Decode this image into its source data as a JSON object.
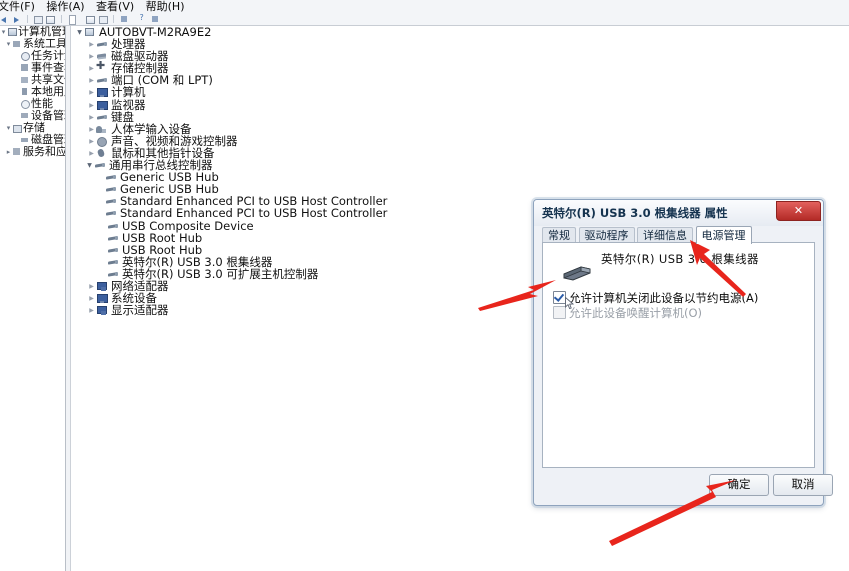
{
  "menubar": {
    "items": [
      {
        "label": "文件(F)"
      },
      {
        "label": "操作(A)"
      },
      {
        "label": "查看(V)"
      },
      {
        "label": "帮助(H)"
      }
    ]
  },
  "toolbar": {
    "icons": [
      "back-arrow-icon",
      "forward-arrow-icon",
      "up-folder-icon",
      "window-icon",
      "properties-icon",
      "list-view-icon",
      "refresh-icon",
      "export-icon",
      "help-icon"
    ]
  },
  "sidebar": {
    "items": [
      {
        "label": "计算机管理(本地",
        "icon": "computer-icon",
        "indent": 0,
        "expander": "-"
      },
      {
        "label": "系统工具",
        "icon": "tools-folder-icon",
        "indent": 1,
        "expander": "-"
      },
      {
        "label": "任务计划程",
        "icon": "clock-icon",
        "indent": 2,
        "expander": ""
      },
      {
        "label": "事件查看器",
        "icon": "event-log-icon",
        "indent": 2,
        "expander": ""
      },
      {
        "label": "共享文件夹",
        "icon": "shared-folder-icon",
        "indent": 2,
        "expander": ""
      },
      {
        "label": "本地用户和",
        "icon": "users-icon",
        "indent": 2,
        "expander": ""
      },
      {
        "label": "性能",
        "icon": "performance-icon",
        "indent": 2,
        "expander": ""
      },
      {
        "label": "设备管理器",
        "icon": "device-manager-icon",
        "indent": 2,
        "expander": ""
      },
      {
        "label": "存储",
        "icon": "storage-icon",
        "indent": 1,
        "expander": "-"
      },
      {
        "label": "磁盘管理",
        "icon": "disk-icon",
        "indent": 2,
        "expander": ""
      },
      {
        "label": "服务和应用程",
        "icon": "services-icon",
        "indent": 1,
        "expander": "+"
      }
    ]
  },
  "device_tree": {
    "root": {
      "label": "AUTOBVT-M2RA9E2",
      "icon": "computer-icon",
      "expander": "▼"
    },
    "items": [
      {
        "label": "处理器",
        "icon": "plug-icon",
        "indent": 1,
        "expander": "▸"
      },
      {
        "label": "磁盘驱动器",
        "icon": "disk-drive-icon",
        "indent": 1,
        "expander": "▸"
      },
      {
        "label": "存储控制器",
        "icon": "storage-controller-icon",
        "indent": 1,
        "expander": "▸"
      },
      {
        "label": "端口 (COM 和 LPT)",
        "icon": "port-icon",
        "indent": 1,
        "expander": "▸"
      },
      {
        "label": "计算机",
        "icon": "computer-node-icon",
        "indent": 1,
        "expander": "▸"
      },
      {
        "label": "监视器",
        "icon": "monitor-icon",
        "indent": 1,
        "expander": "▸"
      },
      {
        "label": "键盘",
        "icon": "keyboard-icon",
        "indent": 1,
        "expander": "▸"
      },
      {
        "label": "人体学输入设备",
        "icon": "hid-icon",
        "indent": 1,
        "expander": "▸"
      },
      {
        "label": "声音、视频和游戏控制器",
        "icon": "sound-icon",
        "indent": 1,
        "expander": "▸"
      },
      {
        "label": "鼠标和其他指针设备",
        "icon": "mouse-icon",
        "indent": 1,
        "expander": "▸"
      },
      {
        "label": "通用串行总线控制器",
        "icon": "usb-icon",
        "indent": 1,
        "expander": "▼"
      },
      {
        "label": "Generic USB Hub",
        "icon": "usb-device-icon",
        "indent": 2,
        "expander": ""
      },
      {
        "label": "Generic USB Hub",
        "icon": "usb-device-icon",
        "indent": 2,
        "expander": ""
      },
      {
        "label": "Standard Enhanced PCI to USB Host Controller",
        "icon": "usb-device-icon",
        "indent": 2,
        "expander": ""
      },
      {
        "label": "Standard Enhanced PCI to USB Host Controller",
        "icon": "usb-device-icon",
        "indent": 2,
        "expander": ""
      },
      {
        "label": "USB Composite Device",
        "icon": "usb-device-icon",
        "indent": 2,
        "expander": ""
      },
      {
        "label": "USB Root Hub",
        "icon": "usb-device-icon",
        "indent": 2,
        "expander": ""
      },
      {
        "label": "USB Root Hub",
        "icon": "usb-device-icon",
        "indent": 2,
        "expander": ""
      },
      {
        "label": "英特尔(R) USB 3.0 根集线器",
        "icon": "usb-device-icon",
        "indent": 2,
        "expander": ""
      },
      {
        "label": "英特尔(R) USB 3.0 可扩展主机控制器",
        "icon": "usb-device-icon",
        "indent": 2,
        "expander": ""
      },
      {
        "label": "网络适配器",
        "icon": "network-icon",
        "indent": 1,
        "expander": "▸"
      },
      {
        "label": "系统设备",
        "icon": "system-device-icon",
        "indent": 1,
        "expander": "▸"
      },
      {
        "label": "显示适配器",
        "icon": "display-adapter-icon",
        "indent": 1,
        "expander": "▸"
      }
    ]
  },
  "dialog": {
    "title": "英特尔(R) USB 3.0 根集线器 属性",
    "close_label": "✕",
    "tabs": [
      {
        "label": "常规",
        "active": false
      },
      {
        "label": "驱动程序",
        "active": false
      },
      {
        "label": "详细信息",
        "active": false
      },
      {
        "label": "电源管理",
        "active": true
      }
    ],
    "device_name": "英特尔(R) USB 3.0 根集线器",
    "checkboxes": [
      {
        "label": "允许计算机关闭此设备以节约电源(A)",
        "checked": true,
        "disabled": false
      },
      {
        "label": "允许此设备唤醒计算机(O)",
        "checked": false,
        "disabled": true
      }
    ],
    "buttons": {
      "ok": "确定",
      "cancel": "取消"
    }
  },
  "annotations": {
    "arrow_color": "#e8251c",
    "arrows": [
      {
        "name": "arrow-to-checkbox",
        "points_at": "允许计算机关闭此设备以节约电源(A)"
      },
      {
        "name": "arrow-to-power-tab",
        "points_at": "电源管理"
      },
      {
        "name": "arrow-to-ok-button",
        "points_at": "确定"
      }
    ]
  }
}
